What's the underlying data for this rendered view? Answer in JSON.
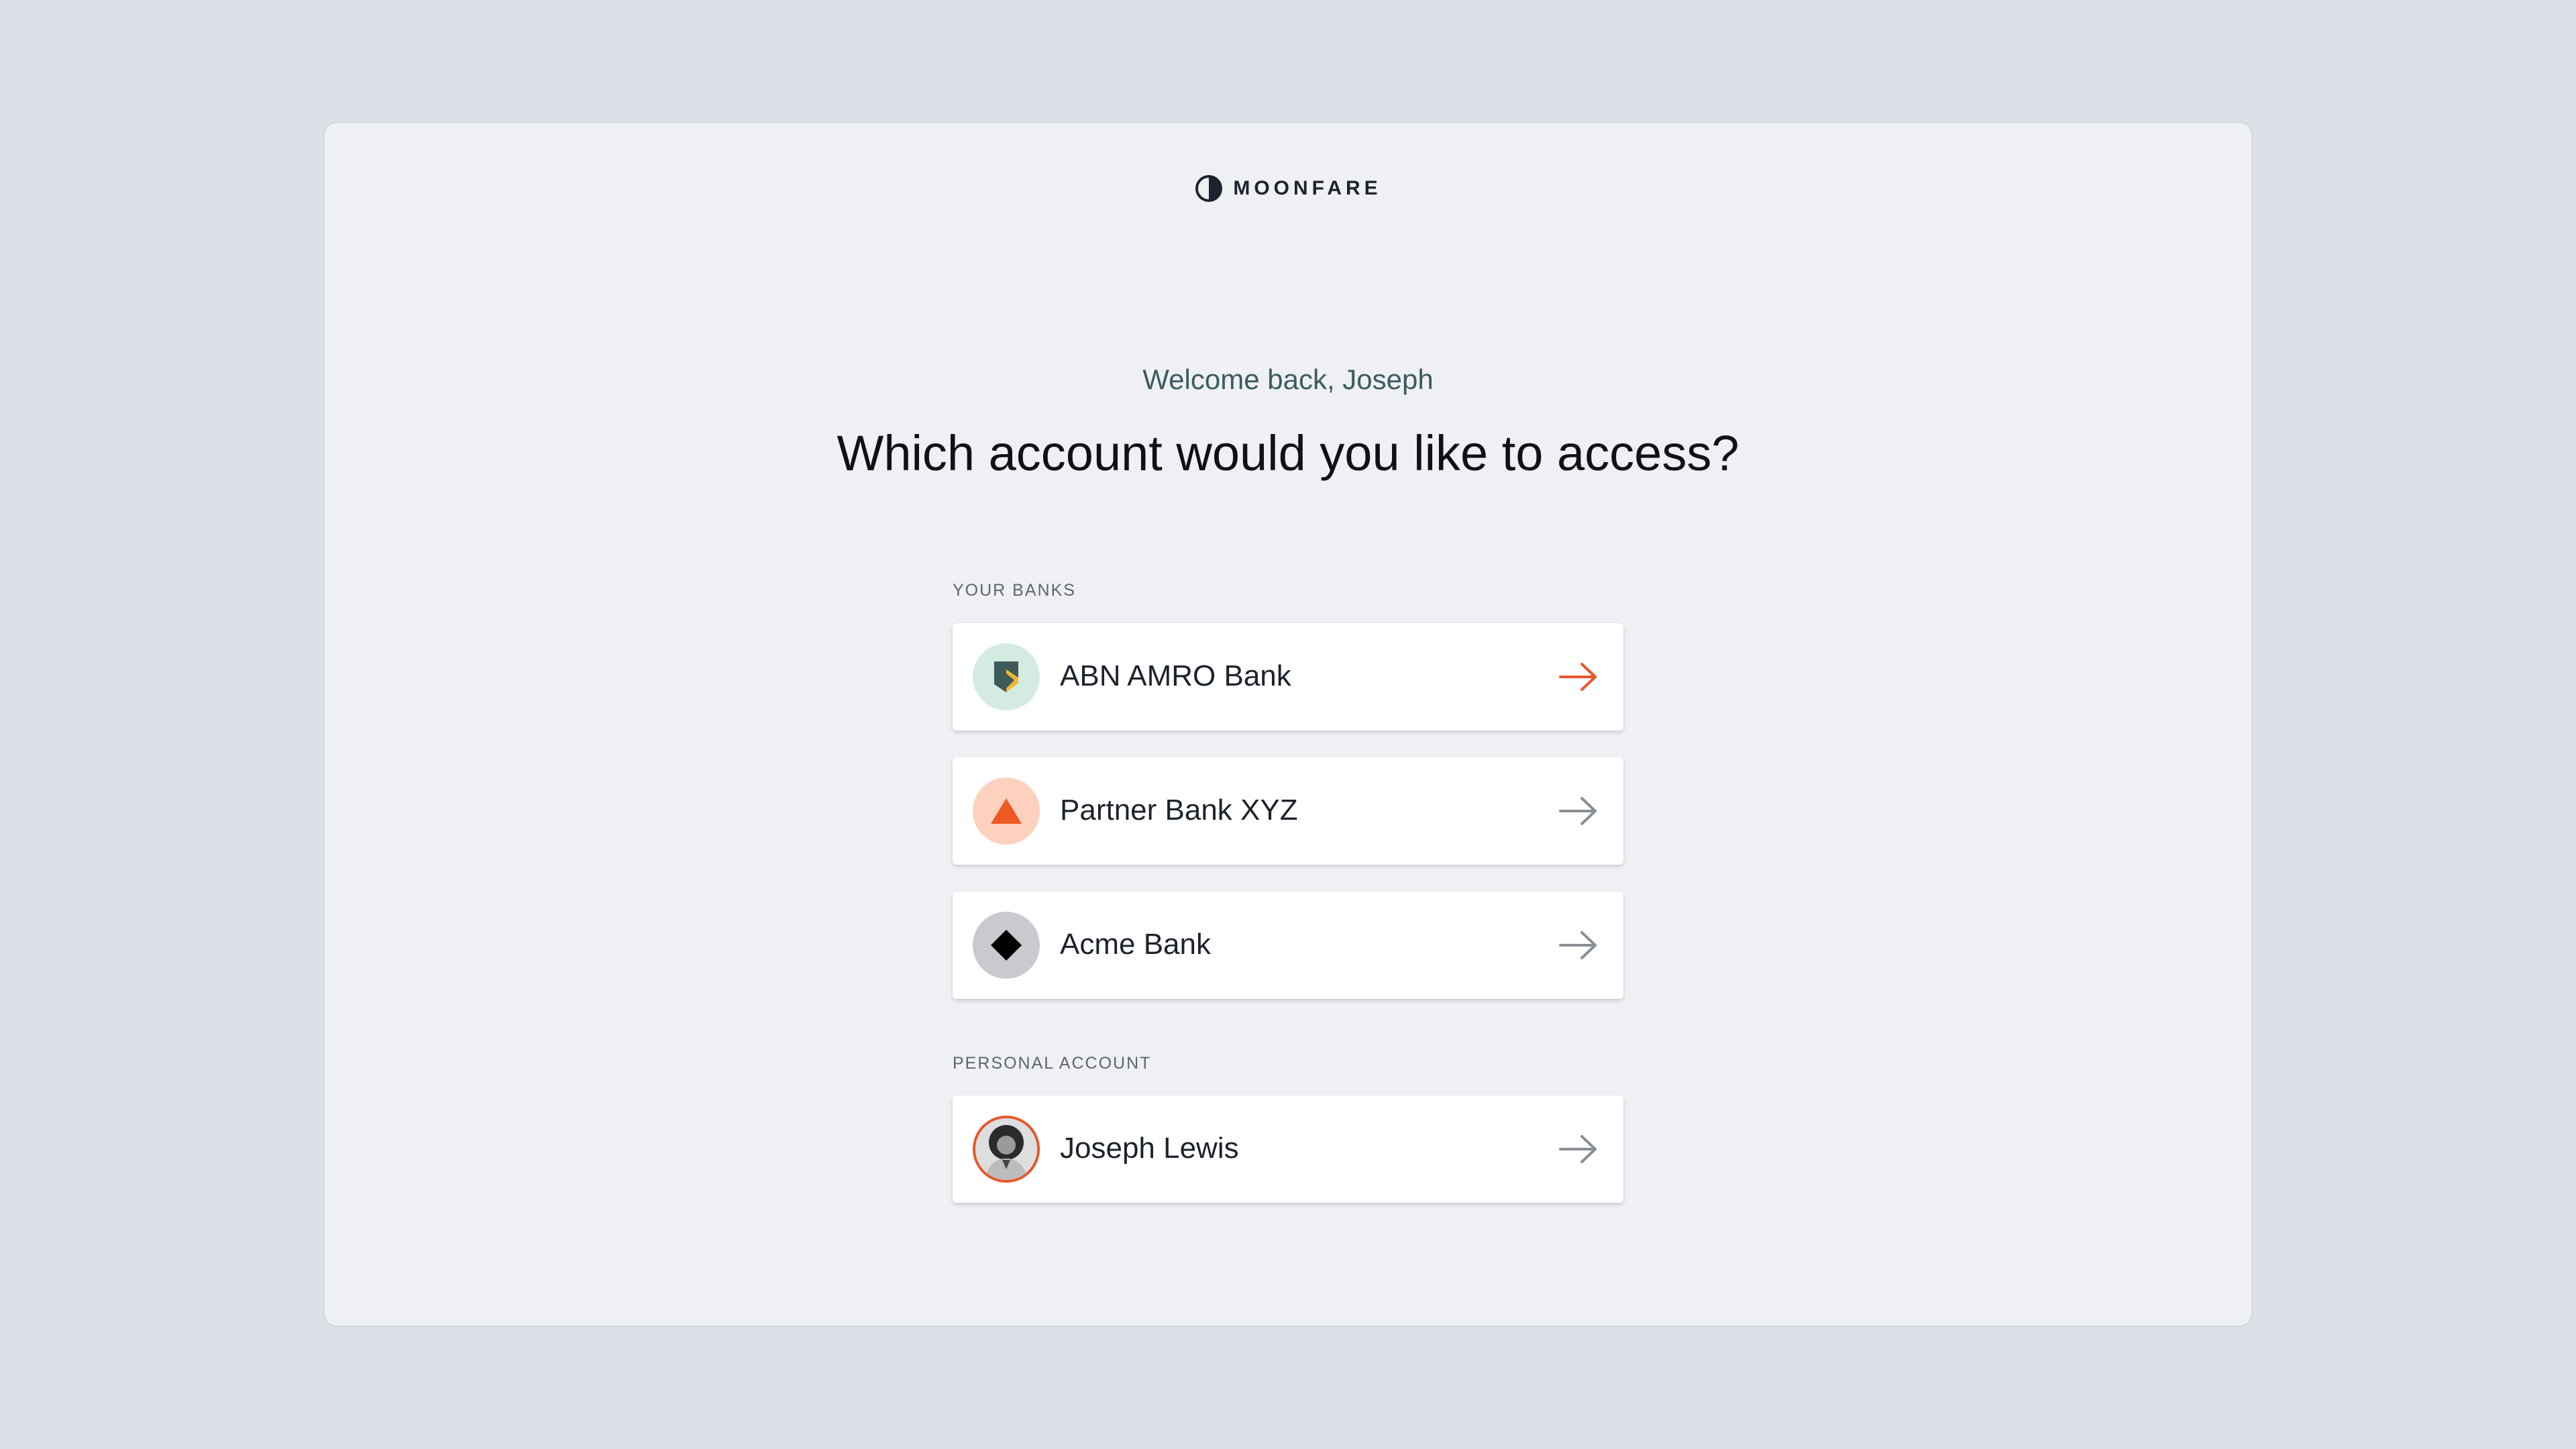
{
  "brand": {
    "name": "MOONFARE",
    "logo_icon": "half-moon-icon"
  },
  "welcome": "Welcome back, Joseph",
  "heading": "Which account would you like to access?",
  "sections": {
    "banks": {
      "label": "YOUR BANKS",
      "items": [
        {
          "name": "ABN AMRO Bank",
          "icon": "abn-amro-shield-icon",
          "avatar_bg": "#d4ebe2",
          "arrow_color": "#e8562a",
          "hovered": true
        },
        {
          "name": "Partner Bank XYZ",
          "icon": "triangle-icon",
          "avatar_bg": "#fdd1bd",
          "arrow_color": "#8a8e95"
        },
        {
          "name": "Acme Bank",
          "icon": "diamond-icon",
          "avatar_bg": "#c8cacf",
          "arrow_color": "#8a8e95"
        }
      ]
    },
    "personal": {
      "label": "PERSONAL ACCOUNT",
      "items": [
        {
          "name": "Joseph Lewis",
          "icon": "profile-photo-avatar",
          "avatar_border": "#e8562a",
          "arrow_color": "#8a8e95"
        }
      ]
    }
  },
  "colors": {
    "page_bg": "#dce0e7",
    "card_bg": "#eef0f4",
    "accent": "#e8562a",
    "welcome_text": "#3c5b5f"
  }
}
